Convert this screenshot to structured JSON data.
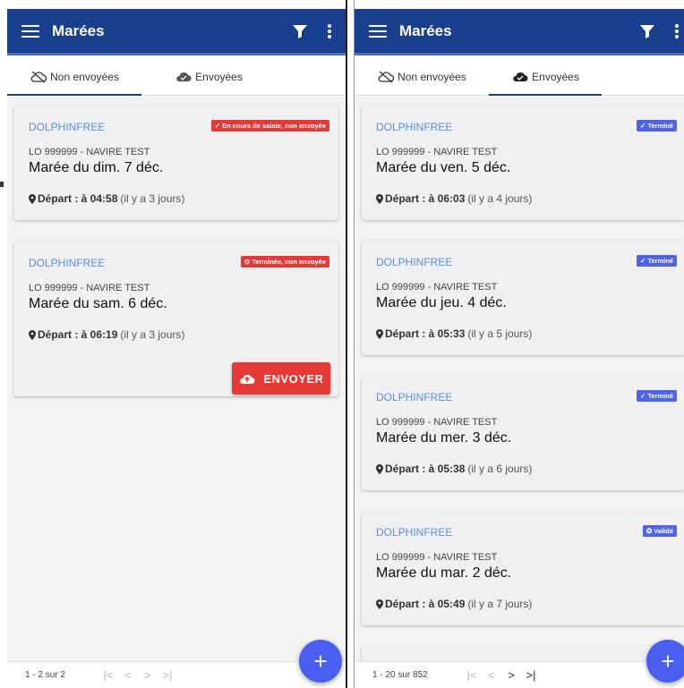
{
  "left": {
    "appbar": {
      "title": "Marées"
    },
    "tabs": [
      {
        "label": "Non envoyées",
        "icon": "cloud-off-icon"
      },
      {
        "label": "Envoyées",
        "icon": "cloud-done-icon"
      }
    ],
    "active_tab": 0,
    "cards": [
      {
        "vessel": "DOLPHINFREE",
        "badge": "✓ En cours de saisie, non envoyée",
        "badge_color": "#e53935",
        "registration": "LO 999999 - NAVIRE TEST",
        "trip_title": "Marée du dim. 7 déc.",
        "departure_label": "Départ : à 04:58",
        "departure_relative": "(il y a 3 jours)"
      },
      {
        "vessel": "DOLPHINFREE",
        "badge": "⊙ Terminée, non envoyée",
        "badge_color": "#e53935",
        "registration": "LO 999999 - NAVIRE TEST",
        "trip_title": "Marée du sam. 6 déc.",
        "departure_label": "Départ : à 06:19",
        "departure_relative": "(il y a 3 jours)",
        "send_label": "ENVOYER"
      }
    ],
    "footer": {
      "range": "1 - 2 sur 2"
    },
    "fab_label": "+"
  },
  "right": {
    "appbar": {
      "title": "Marées"
    },
    "tabs": [
      {
        "label": "Non envoyées",
        "icon": "cloud-off-icon"
      },
      {
        "label": "Envoyées",
        "icon": "cloud-done-icon"
      }
    ],
    "active_tab": 1,
    "cards": [
      {
        "vessel": "DOLPHINFREE",
        "badge": "✓ Terminé",
        "badge_color": "#4f63e8",
        "registration": "LO 999999 - NAVIRE TEST",
        "trip_title": "Marée du ven. 5 déc.",
        "departure_label": "Départ : à 06:03",
        "departure_relative": "(il y a 4 jours)"
      },
      {
        "vessel": "DOLPHINFREE",
        "badge": "✓ Terminé",
        "badge_color": "#4f63e8",
        "registration": "LO 999999 - NAVIRE TEST",
        "trip_title": "Marée du jeu. 4 déc.",
        "departure_label": "Départ : à 05:33",
        "departure_relative": "(il y a 5 jours)"
      },
      {
        "vessel": "DOLPHINFREE",
        "badge": "✓ Terminé",
        "badge_color": "#4f63e8",
        "registration": "LO 999999 - NAVIRE TEST",
        "trip_title": "Marée du mer. 3 déc.",
        "departure_label": "Départ : à 05:38",
        "departure_relative": "(il y a 6 jours)"
      },
      {
        "vessel": "DOLPHINFREE",
        "badge": "✪ Validé",
        "badge_color": "#4f63e8",
        "registration": "LO 999999 - NAVIRE TEST",
        "trip_title": "Marée du mar. 2 déc.",
        "departure_label": "Départ : à 05:49",
        "departure_relative": "(il y a 7 jours)"
      }
    ],
    "footer": {
      "range": "1 - 20 sur 852"
    },
    "fab_label": "+"
  },
  "pagination_glyphs": {
    "first": "|<",
    "prev": "<",
    "next": ">",
    "last": ">|"
  },
  "colors": {
    "appbar": "#1b3f8f",
    "accent": "#4a5ff0",
    "error": "#e53935",
    "vessel_link": "#5b8fd8"
  }
}
